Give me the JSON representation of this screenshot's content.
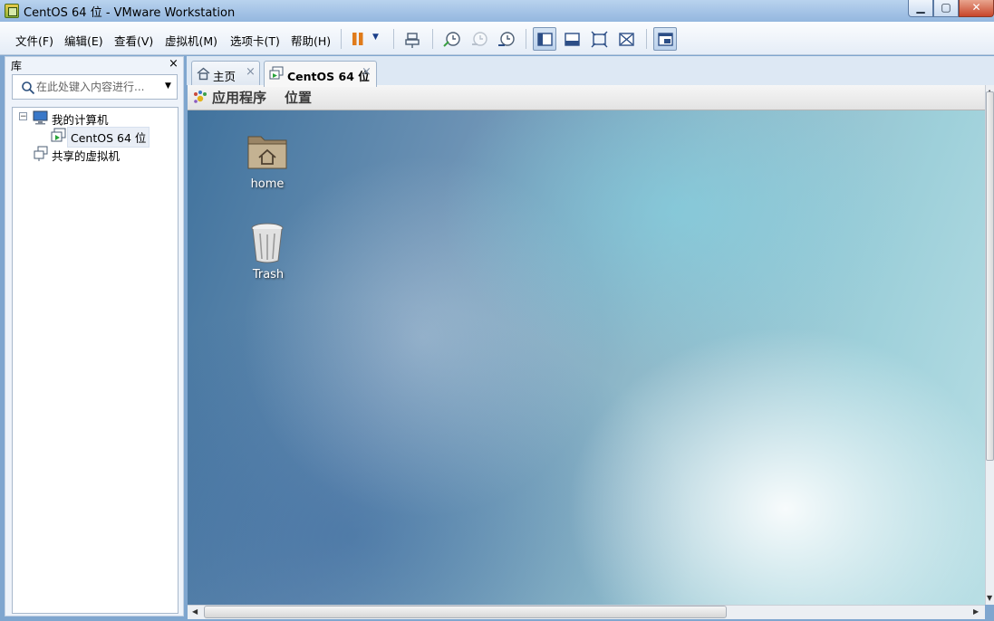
{
  "window": {
    "title": "CentOS 64 位 - VMware Workstation"
  },
  "menu": [
    {
      "label": "文件(F)"
    },
    {
      "label": "编辑(E)"
    },
    {
      "label": "查看(V)"
    },
    {
      "label": "虚拟机(M)"
    },
    {
      "label": "选项卡(T)"
    },
    {
      "label": "帮助(H)"
    }
  ],
  "library": {
    "title": "库",
    "close_glyph": "×",
    "search_placeholder": "在此处键入内容进行...",
    "tree": {
      "my_computer": "我的计算机",
      "vm": "CentOS 64 位",
      "shared": "共享的虚拟机"
    }
  },
  "tabs": [
    {
      "label": "主页",
      "close": "×"
    },
    {
      "label": "CentOS 64 位",
      "close": "×"
    }
  ],
  "guest": {
    "panel_menu": [
      "应用程序",
      "位置"
    ],
    "desktop_icons": [
      {
        "label": "home",
        "icon": "home-folder-icon"
      },
      {
        "label": "Trash",
        "icon": "trash-icon"
      }
    ]
  },
  "colors": {
    "pause_orange": "#e07b1a",
    "titlebar": "#a4c3e6"
  }
}
